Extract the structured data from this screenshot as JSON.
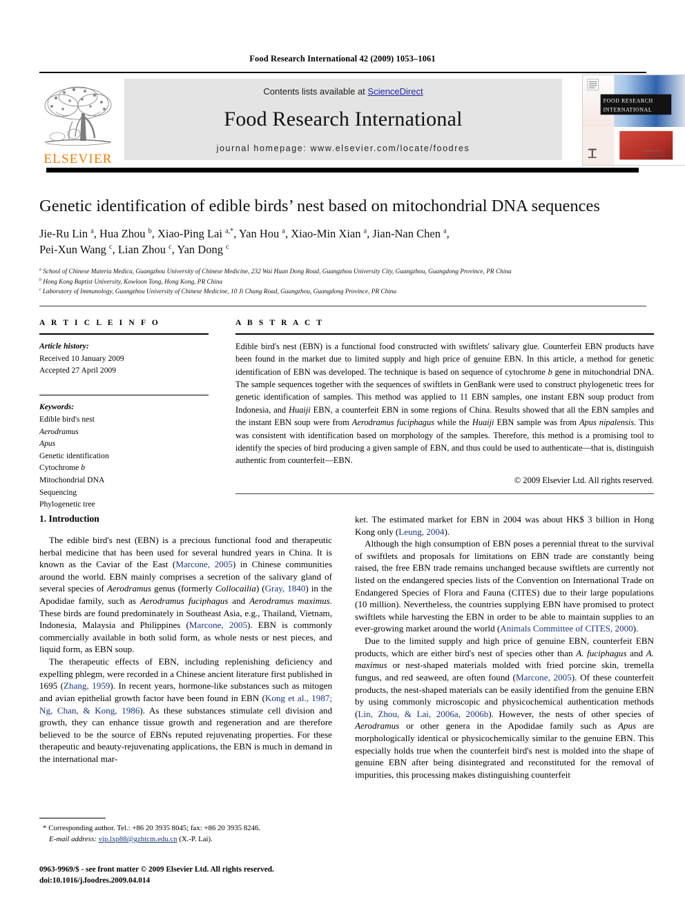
{
  "running_head": "Food Research International 42 (2009) 1053–1061",
  "masthead": {
    "contents_prefix": "Contents lists available at ",
    "sciencedirect": "ScienceDirect",
    "journal_title": "Food Research International",
    "homepage": "journal homepage: www.elsevier.com/locate/foodres",
    "publisher_logo_word": "ELSEVIER",
    "cover_title_line1": "FOOD RESEARCH",
    "cover_title_line2": "INTERNATIONAL",
    "accent_orange": "#F07D00",
    "banner_bg": "#e4e4e4",
    "link_blue": "#2222aa"
  },
  "article": {
    "title": "Genetic identification of edible birds’ nest based on mitochondrial DNA sequences",
    "authors_line1": "Jie-Ru Lin a, Hua Zhou b, Xiao-Ping Lai a,*, Yan Hou a, Xiao-Min Xian a, Jian-Nan Chen a,",
    "authors_line2": "Pei-Xun Wang c, Lian Zhou c, Yan Dong c",
    "affiliations": [
      "a School of Chinese Materia Medica, Guangzhou University of Chinese Medicine, 232 Wai Huan Dong Road, Guangzhou University City, Guangzhou, Guangdong Province, PR China",
      "b Hong Kong Baptist University, Kowloon Tong, Hong Kong, PR China",
      "c Laboratory of Immunology, Guangzhou University of Chinese Medicine, 10 Ji Chang Road, Guangzhou, Guangdong Province, PR China"
    ]
  },
  "article_info": {
    "heading": "A R T I C L E  I N F O",
    "history_label": "Article history:",
    "received": "Received 10 January 2009",
    "accepted": "Accepted 27 April 2009",
    "keywords_label": "Keywords:",
    "keywords": [
      "Edible bird's nest",
      "Aerodramus",
      "Apus",
      "Genetic identification",
      "Cytochrome b",
      "Mitochondrial DNA",
      "Sequencing",
      "Phylogenetic tree"
    ]
  },
  "abstract": {
    "heading": "A B S T R A C T",
    "text": "Edible bird's nest (EBN) is a functional food constructed with swiftlets' salivary glue. Counterfeit EBN products have been found in the market due to limited supply and high price of genuine EBN. In this article, a method for genetic identification of EBN was developed. The technique is based on sequence of cytochrome b gene in mitochondrial DNA. The sample sequences together with the sequences of swiftlets in GenBank were used to construct phylogenetic trees for genetic identification of samples. This method was applied to 11 EBN samples, one instant EBN soup product from Indonesia, and Huaiji EBN, a counterfeit EBN in some regions of China. Results showed that all the EBN samples and the instant EBN soup were from Aerodramus fuciphagus while the Huaiji EBN sample was from Apus nipalensis. This was consistent with identification based on morphology of the samples. Therefore, this method is a promising tool to identify the species of bird producing a given sample of EBN, and thus could be used to authenticate—that is, distinguish authentic from counterfeit—EBN.",
    "copyright": "© 2009 Elsevier Ltd. All rights reserved."
  },
  "introduction": {
    "heading": "1. Introduction",
    "left_paragraphs": [
      "The edible bird's nest (EBN) is a precious functional food and therapeutic herbal medicine that has been used for several hundred years in China. It is known as the Caviar of the East (Marcone, 2005) in Chinese communities around the world. EBN mainly comprises a secretion of the salivary gland of several species of Aerodramus genus (formerly Collocailia) (Gray, 1840) in the Apodidae family, such as Aerodramus fuciphagus and Aerodramus maximus. These birds are found predominately in Southeast Asia, e.g., Thailand, Vietnam, Indonesia, Malaysia and Philippines (Marcone, 2005). EBN is commonly commercially available in both solid form, as whole nests or nest pieces, and liquid form, as EBN soup.",
      "The therapeutic effects of EBN, including replenishing deficiency and expelling phlegm, were recorded in a Chinese ancient literature first published in 1695 (Zhang, 1959). In recent years, hormone-like substances such as mitogen and avian epithelial growth factor have been found in EBN (Kong et al., 1987; Ng, Chan, & Kong, 1986). As these substances stimulate cell division and growth, they can enhance tissue growth and regeneration and are therefore believed to be the source of EBNs reputed rejuvenating properties. For these therapeutic and beauty-rejuvenating applications, the EBN is much in demand in the international mar-"
    ],
    "right_paragraphs": [
      "ket. The estimated market for EBN in 2004 was about HK$ 3 billion in Hong Kong only (Leung, 2004).",
      "Although the high consumption of EBN poses a perennial threat to the survival of swiftlets and proposals for limitations on EBN trade are constantly being raised, the free EBN trade remains unchanged because swiftlets are currently not listed on the endangered species lists of the Convention on International Trade on Endangered Species of Flora and Fauna (CITES) due to their large populations (10 million). Nevertheless, the countries supplying EBN have promised to protect swiftlets while harvesting the EBN in order to be able to maintain supplies to an ever-growing market around the world (Animals Committee of CITES, 2000).",
      "Due to the limited supply and high price of genuine EBN, counterfeit EBN products, which are either bird's nest of species other than A. fuciphagus and A. maximus or nest-shaped materials molded with fried porcine skin, tremella fungus, and red seaweed, are often found (Marcone, 2005). Of these counterfeit products, the nest-shaped materials can be easily identified from the genuine EBN by using commonly microscopic and physicochemical authentication methods (Lin, Zhou, & Lai, 2006a, 2006b). However, the nests of other species of Aerodramus or other genera in the Apodidae family such as Apus are morphologically identical or physicochemically similar to the genuine EBN. This especially holds true when the counterfeit bird's nest is molded into the shape of genuine EBN after being disintegrated and reconstituted for the removal of impurities, this processing makes distinguishing counterfeit"
    ]
  },
  "footnote": {
    "star": "*",
    "corresponding": "Corresponding author. Tel.: +86 20 3935 8045; fax: +86 20 3935 8246.",
    "email_label": "E-mail address:",
    "email": "vip.lxp88@gzhtcm.edu.cn",
    "email_owner": "(X.-P. Lai)."
  },
  "imprint": {
    "line1": "0963-9969/$ - see front matter © 2009 Elsevier Ltd. All rights reserved.",
    "line2": "doi:10.1016/j.foodres.2009.04.014"
  }
}
